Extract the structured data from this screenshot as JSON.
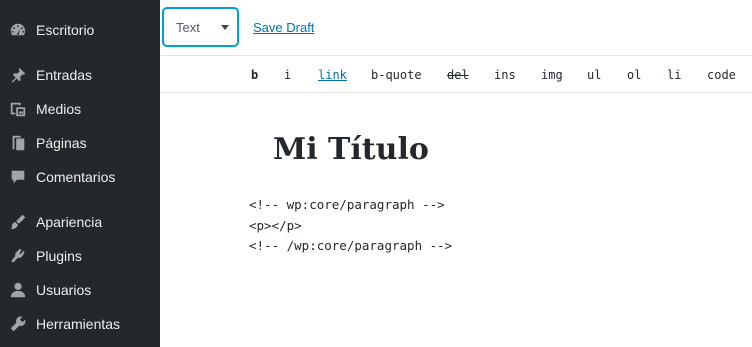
{
  "sidebar": {
    "items": [
      {
        "label": "Escritorio",
        "icon": "dashboard-icon"
      },
      {
        "label": "Entradas",
        "icon": "pin-icon"
      },
      {
        "label": "Medios",
        "icon": "media-icon"
      },
      {
        "label": "Páginas",
        "icon": "pages-icon"
      },
      {
        "label": "Comentarios",
        "icon": "comments-icon"
      },
      {
        "label": "Apariencia",
        "icon": "brush-icon"
      },
      {
        "label": "Plugins",
        "icon": "plugin-icon"
      },
      {
        "label": "Usuarios",
        "icon": "user-icon"
      },
      {
        "label": "Herramientas",
        "icon": "wrench-icon"
      }
    ]
  },
  "topbar": {
    "mode_select_value": "Text",
    "save_draft_label": "Save Draft"
  },
  "quicktags": [
    "b",
    "i",
    "link",
    "b-quote",
    "del",
    "ins",
    "img",
    "ul",
    "ol",
    "li",
    "code"
  ],
  "editor": {
    "title": "Mi Título",
    "content_lines": [
      "<!-- wp:core/paragraph -->",
      "<p></p>",
      "<!-- /wp:core/paragraph -->"
    ]
  },
  "colors": {
    "sidebar_bg": "#23282d",
    "sidebar_text": "#eeeeee",
    "icon_color": "#a0a5aa",
    "accent": "#0073aa",
    "focus_border": "#00a0d2"
  }
}
